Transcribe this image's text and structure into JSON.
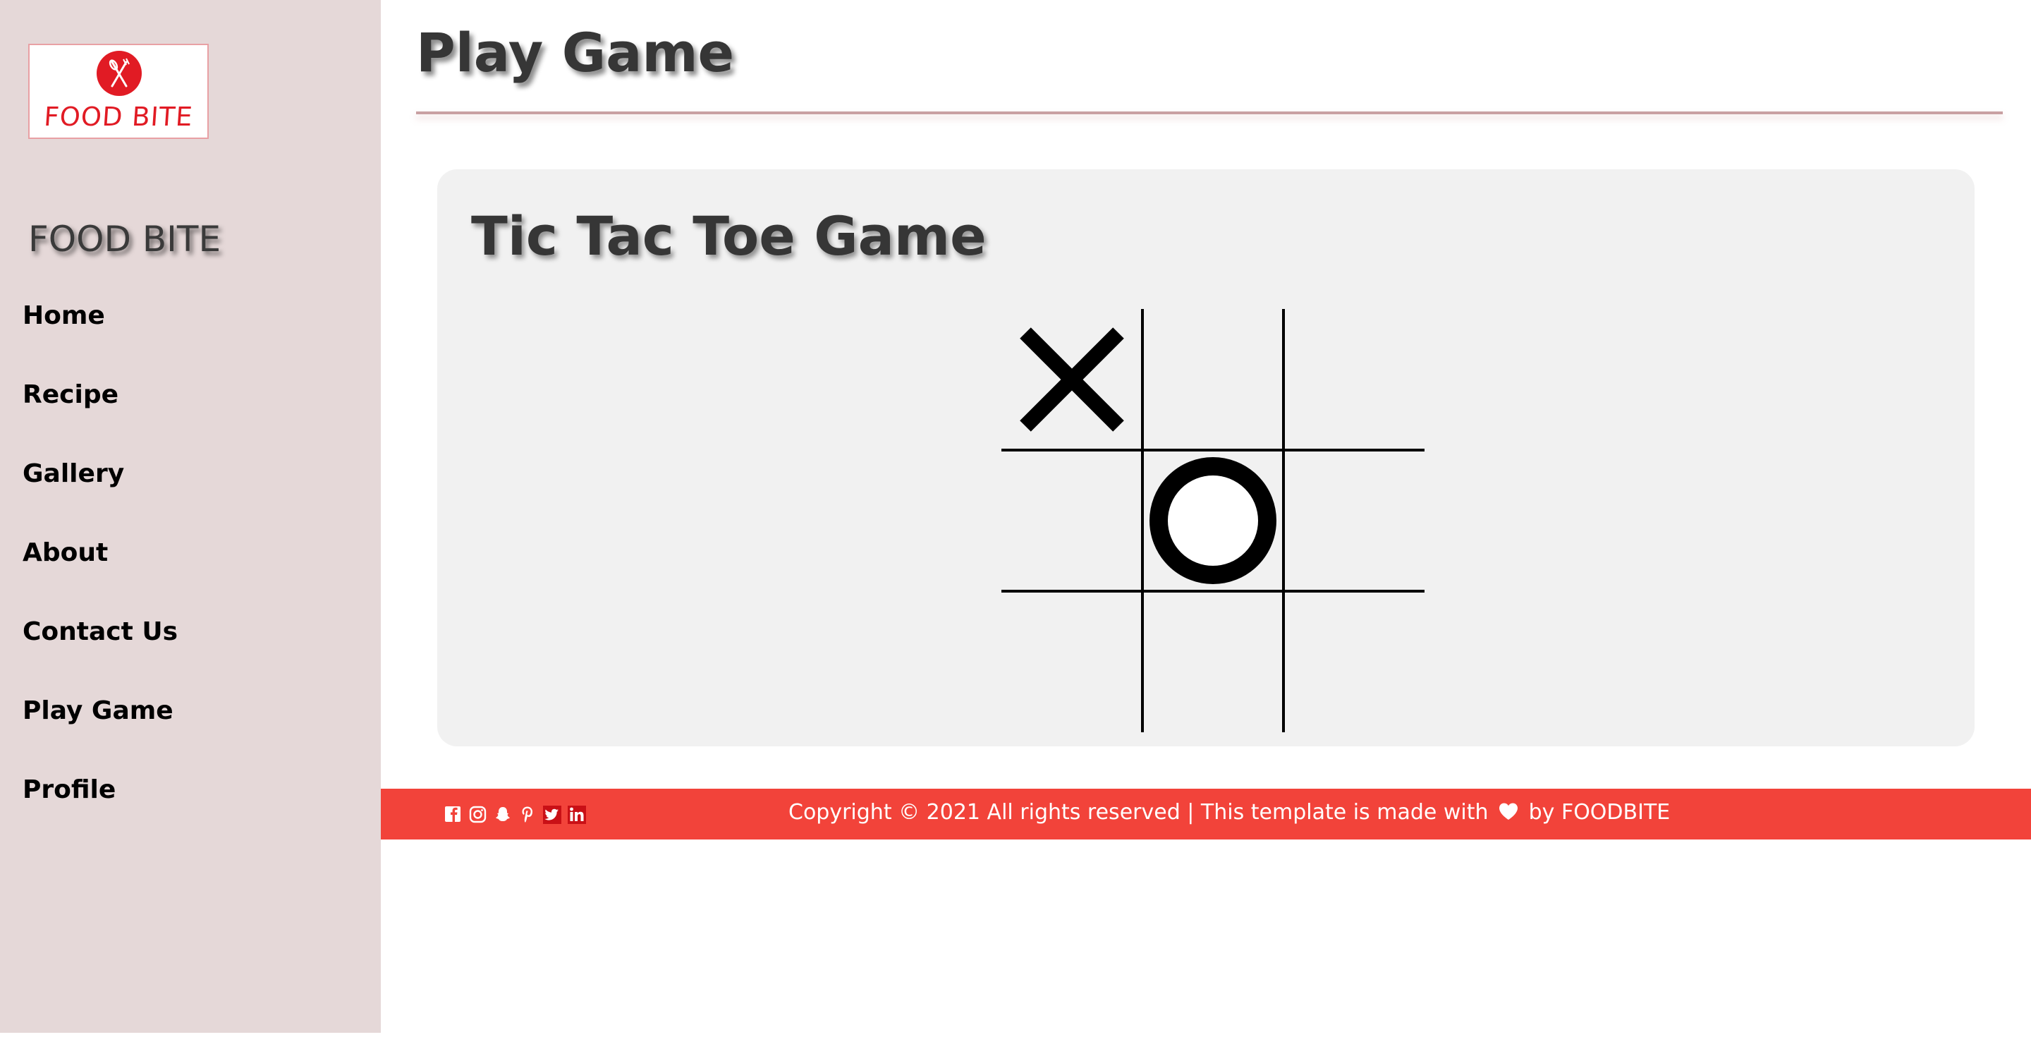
{
  "sidebar": {
    "logo_text": "FOOD BITE",
    "brand_name": "FOOD BITE",
    "nav": [
      {
        "label": "Home"
      },
      {
        "label": "Recipe"
      },
      {
        "label": "Gallery"
      },
      {
        "label": "About"
      },
      {
        "label": "Contact Us"
      },
      {
        "label": "Play Game"
      },
      {
        "label": "Profile"
      }
    ]
  },
  "header": {
    "title": "Play Game"
  },
  "game": {
    "title": "Tic Tac Toe Game",
    "board": [
      "X",
      "",
      "",
      "",
      "O",
      "",
      "",
      "",
      ""
    ]
  },
  "footer": {
    "social_icons": [
      "facebook-icon",
      "instagram-icon",
      "snapchat-icon",
      "pinterest-icon",
      "twitter-icon",
      "linkedin-icon"
    ],
    "copyright_prefix": "Copyright © 2021 All rights reserved | This template is made with",
    "copyright_suffix": "by FOODBITE"
  },
  "colors": {
    "sidebar_bg": "#e5d8d8",
    "brand_red": "#e11b24",
    "footer_bg": "#f2433a",
    "card_bg": "#f1f1f1"
  }
}
